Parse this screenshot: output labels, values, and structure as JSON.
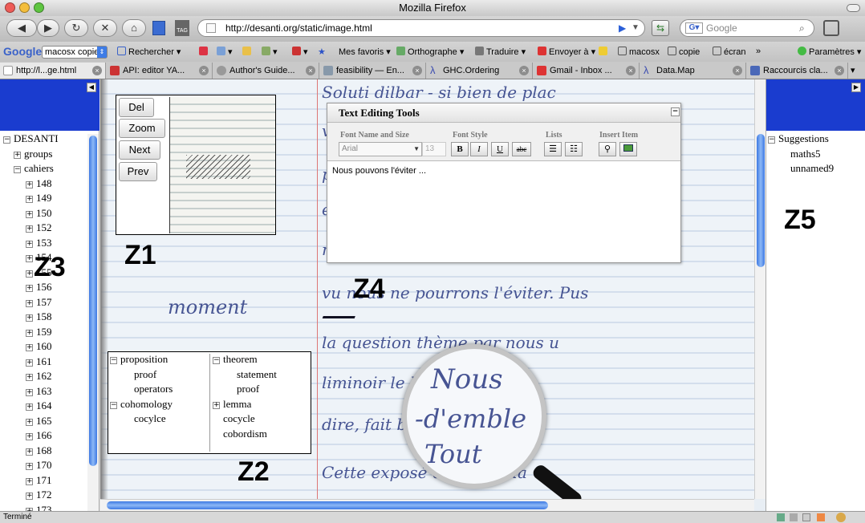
{
  "window": {
    "title": "Mozilla Firefox"
  },
  "nav": {
    "url": "http://desanti.org/static/image.html",
    "search_placeholder": "Google"
  },
  "gbar": {
    "brand": "Google",
    "select_value": "macosx copie",
    "items": [
      "Rechercher",
      "Mes favoris",
      "Orthographe",
      "Traduire",
      "Envoyer à",
      "macosx",
      "copie",
      "écran",
      "»",
      "Paramètres"
    ]
  },
  "tabs": [
    "http://l...ge.html",
    "API: editor YA...",
    "Author's Guide...",
    "feasibility — En...",
    "GHC.Ordering",
    "Gmail - Inbox ...",
    "Data.Map",
    "Raccourcis cla..."
  ],
  "left_tree": {
    "root": "DESANTI",
    "groups": "groups",
    "cahiers": "cahiers",
    "items": [
      "148",
      "149",
      "150",
      "152",
      "153",
      "154",
      "155",
      "156",
      "157",
      "158",
      "159",
      "160",
      "161",
      "162",
      "163",
      "164",
      "165",
      "166",
      "168",
      "170",
      "171",
      "172",
      "173"
    ]
  },
  "right_tree": {
    "root": "Suggestions",
    "items": [
      "maths5",
      "unnamed9"
    ]
  },
  "z1": {
    "buttons": [
      "Del",
      "Zoom",
      "Next",
      "Prev"
    ]
  },
  "z2": {
    "left": [
      {
        "label": "proposition",
        "children": [
          "proof",
          "operators"
        ]
      },
      {
        "label": "cohomology",
        "children": [
          "cocylce"
        ]
      }
    ],
    "right": [
      {
        "label": "theorem",
        "children": [
          "statement",
          "proof"
        ]
      },
      {
        "label": "lemma"
      },
      {
        "label": "cocycle"
      },
      {
        "label": "cobordism"
      }
    ]
  },
  "editor": {
    "title": "Text Editing Tools",
    "groups": [
      "Font Name and Size",
      "Font Style",
      "Lists",
      "Insert Item"
    ],
    "font_name": "Arial",
    "font_size": "13",
    "style_buttons": [
      "B",
      "I",
      "U",
      "abc"
    ],
    "content": "Nous pouvons l'éviter ..."
  },
  "zones": [
    "Z1",
    "Z2",
    "Z3",
    "Z4",
    "Z5"
  ],
  "handwriting": {
    "moment": "moment",
    "lines": [
      "Soluti dilbar - si bien  de plac",
      "voir le moyen des facteur  tacin",
      "   pour ne          le  mem",
      "  en vue des         protée",
      "  nous pouchons  pour    le  prot",
      "   vu  nous ne pourrons l'éviter. Pus",
      "la question  thème  par nous u",
      "liminoir      le barème sur",
      "dire, fait   bat  ensemble,  dis",
      "Cette exposé      concerne  la"
    ],
    "magnifier": [
      "Nous",
      "-d'emble",
      "Tout"
    ]
  },
  "status": {
    "text": "Terminé"
  }
}
